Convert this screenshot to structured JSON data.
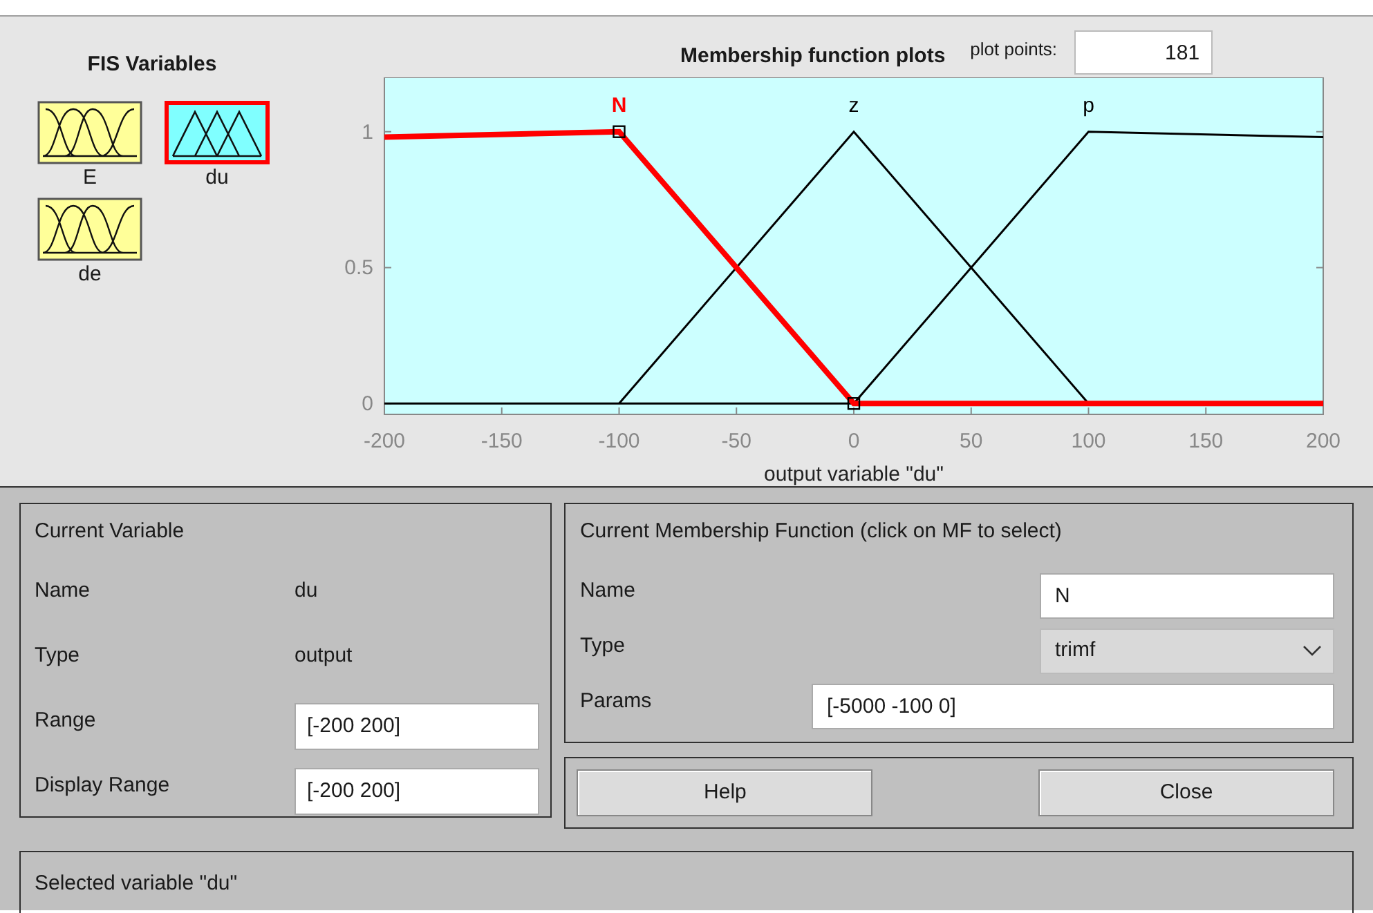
{
  "variables_panel": {
    "title": "FIS Variables",
    "variables": [
      {
        "name": "E",
        "kind": "input",
        "selected": false
      },
      {
        "name": "du",
        "kind": "output",
        "selected": true
      },
      {
        "name": "de",
        "kind": "input",
        "selected": false
      }
    ]
  },
  "plot": {
    "title": "Membership function plots",
    "plot_points_label": "plot points:",
    "plot_points": "181",
    "chart_data": {
      "type": "line",
      "xlabel": "output variable \"du\"",
      "x": [
        -200,
        -100,
        0,
        100,
        200
      ],
      "series": [
        {
          "name": "N",
          "color": "#ff0000",
          "values": [
            0.98,
            1,
            0,
            0,
            0
          ]
        },
        {
          "name": "z",
          "color": "#000000",
          "values": [
            null,
            0,
            1,
            0,
            null
          ]
        },
        {
          "name": "p",
          "color": "#000000",
          "values": [
            null,
            null,
            0,
            1,
            0.98
          ]
        }
      ],
      "xlim": [
        -200,
        200
      ],
      "ylim": [
        -0.04,
        1.2
      ],
      "xticks": [
        -200,
        -150,
        -100,
        -50,
        0,
        50,
        100,
        150,
        200
      ],
      "yticks": [
        0,
        0.5,
        1
      ]
    },
    "membership_functions": [
      {
        "selected": true
      },
      {
        "selected": false
      },
      {
        "selected": false
      }
    ]
  },
  "current_variable": {
    "title": "Current Variable",
    "fields": [
      {
        "label": "Name",
        "value": "du",
        "kind": "text"
      },
      {
        "label": "Type",
        "value": "output",
        "kind": "text"
      },
      {
        "label": "Range",
        "value": "[-200 200]",
        "kind": "input"
      },
      {
        "label": "Display Range",
        "value": "[-200 200]",
        "kind": "input"
      }
    ]
  },
  "current_mf": {
    "title": "Current Membership Function (click on MF to select)",
    "fields": [
      {
        "label": "Name",
        "value": "N",
        "kind": "input"
      },
      {
        "label": "Type",
        "value": "trimf",
        "kind": "select"
      },
      {
        "label": "Params",
        "value": "[-5000 -100 0]",
        "kind": "wide_input"
      }
    ]
  },
  "buttons": [
    "Help",
    "Close"
  ],
  "status": "Selected variable \"du\""
}
